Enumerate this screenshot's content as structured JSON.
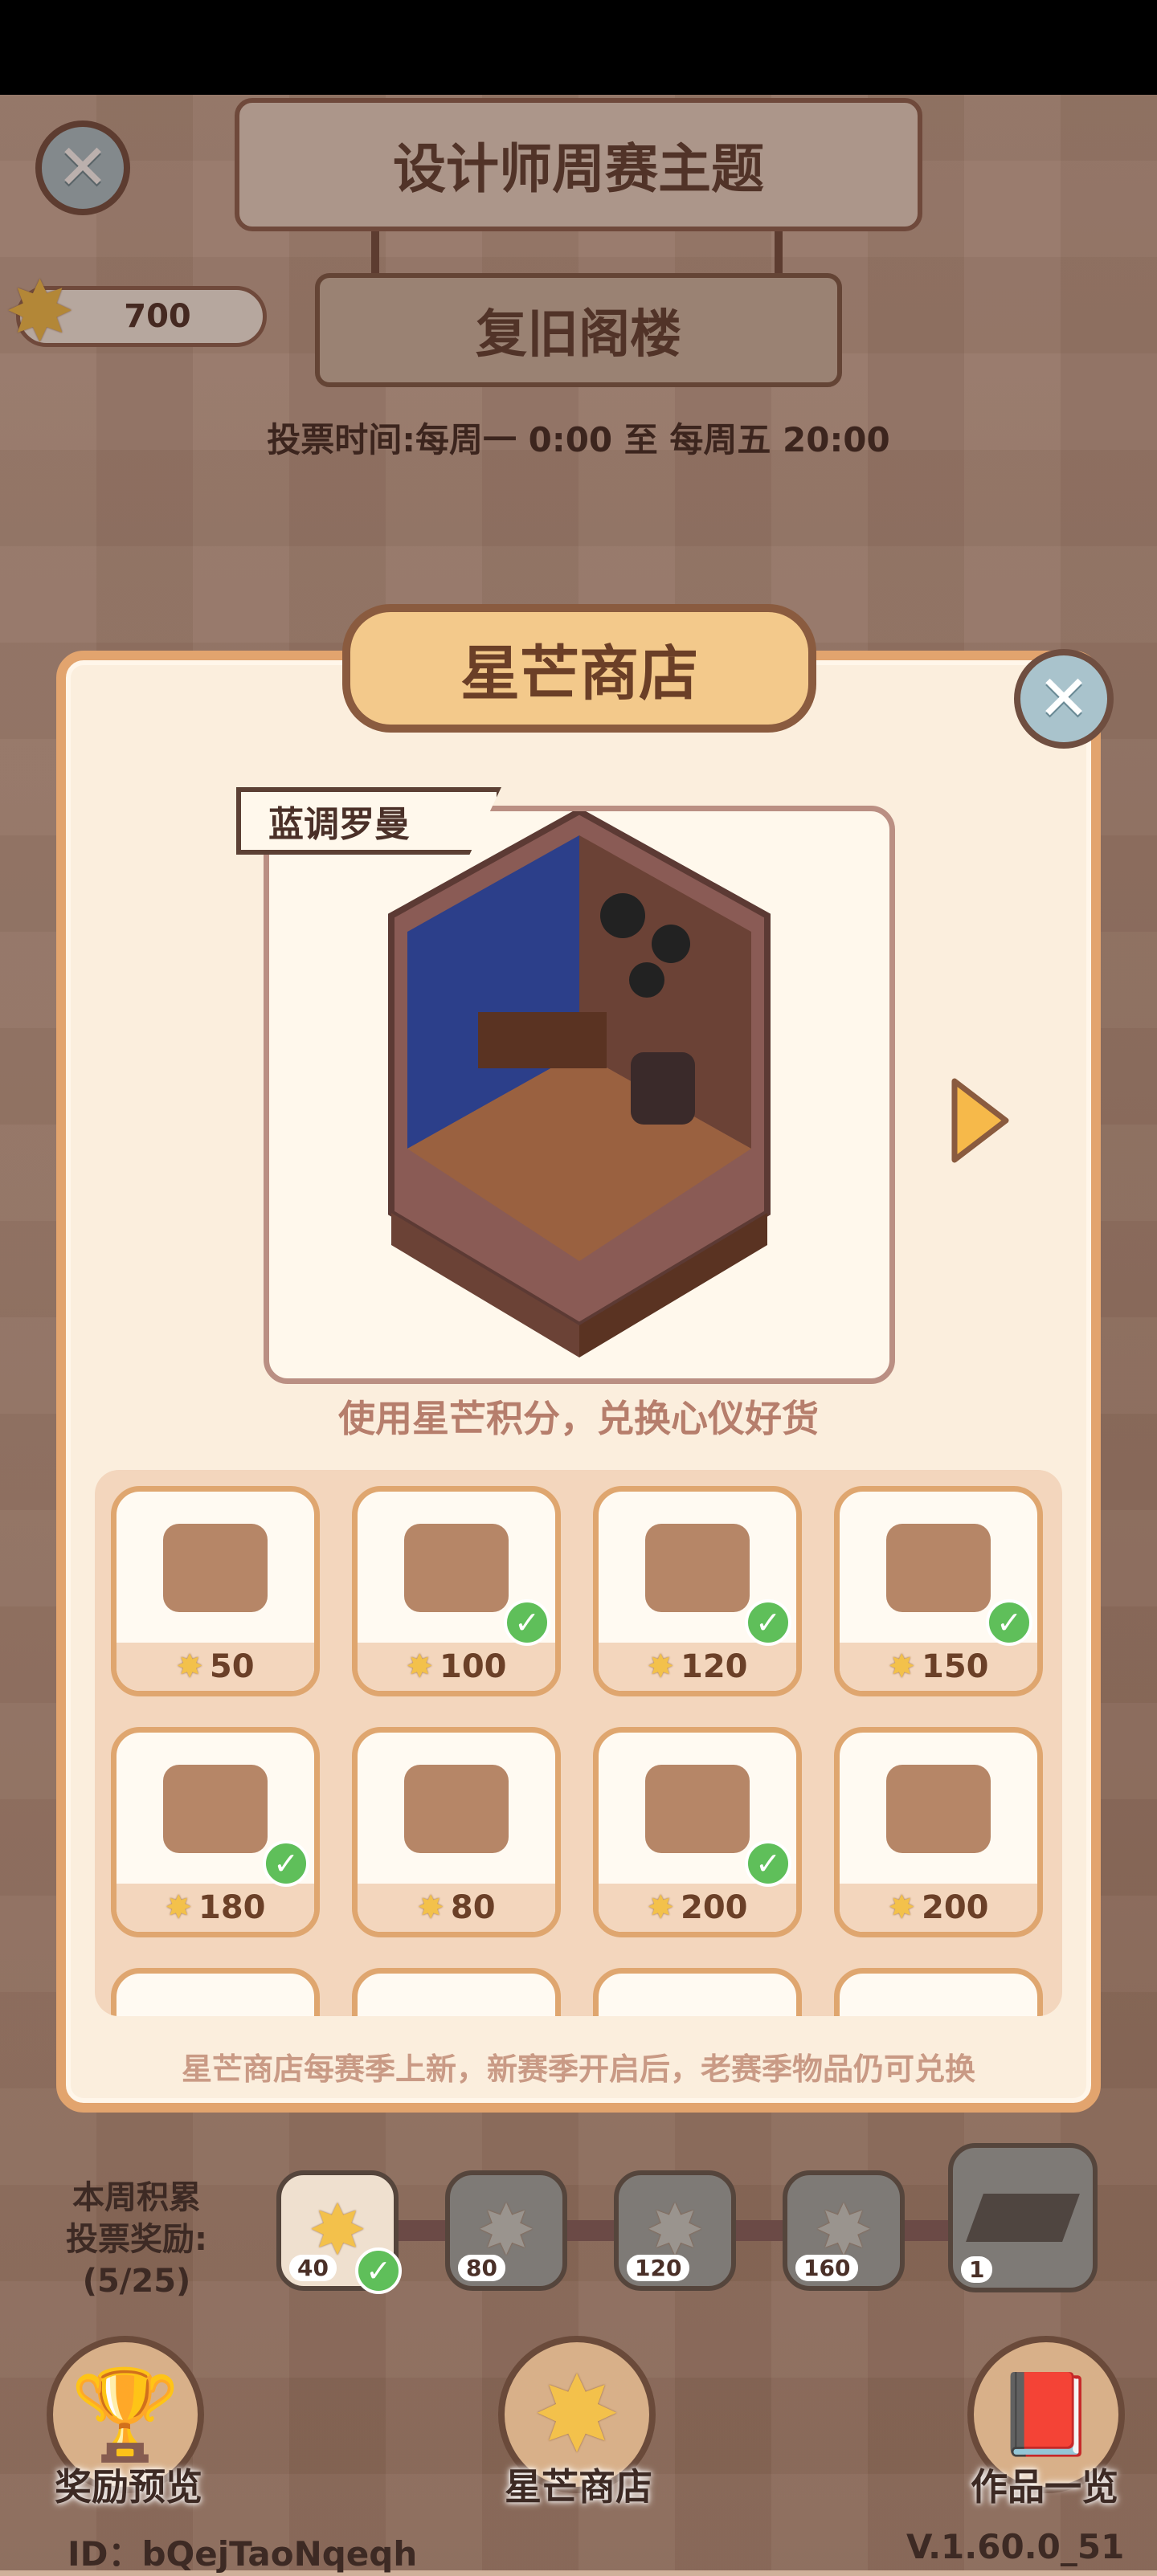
{
  "header": {
    "weekly_theme_title": "设计师周赛主题",
    "theme_name": "复旧阁楼",
    "vote_time": "投票时间:每周一 0:00 至 每周五 20:00",
    "star_points": "700"
  },
  "shop": {
    "title": "星芒商店",
    "featured_name": "蓝调罗曼",
    "subtitle": "使用星芒积分，兑换心仪好货",
    "note": "星芒商店每赛季上新，新赛季开启后，老赛季物品仍可兑换",
    "items": [
      {
        "icon": "cocktail-tray-icon",
        "price": "50",
        "owned": false
      },
      {
        "icon": "accordion-icon",
        "price": "100",
        "owned": true
      },
      {
        "icon": "guitar-icon",
        "price": "120",
        "owned": true
      },
      {
        "icon": "saxophone-icon",
        "price": "150",
        "owned": true
      },
      {
        "icon": "horn-stand-icon",
        "price": "180",
        "owned": true
      },
      {
        "icon": "wood-floor-icon",
        "price": "80",
        "owned": false
      },
      {
        "icon": "piano-table-icon",
        "price": "200",
        "owned": true
      },
      {
        "icon": "wood-bench-icon",
        "price": "200",
        "owned": false
      }
    ]
  },
  "rewards": {
    "label_line1": "本周积累",
    "label_line2": "投票奖励:",
    "label_line3": "(5/25)",
    "tiers": [
      "40",
      "80",
      "120",
      "160",
      "1"
    ]
  },
  "bottom_nav": {
    "reward_preview": "奖励预览",
    "star_shop": "星芒商店",
    "works_list": "作品一览"
  },
  "footer": {
    "user_id": "ID：bQejTaoNqeqh",
    "version": "V.1.60.0_51"
  },
  "colors": {
    "panel_border": "#e2a46e",
    "check_green": "#5fbf5a",
    "text_brown": "#4a3028"
  }
}
